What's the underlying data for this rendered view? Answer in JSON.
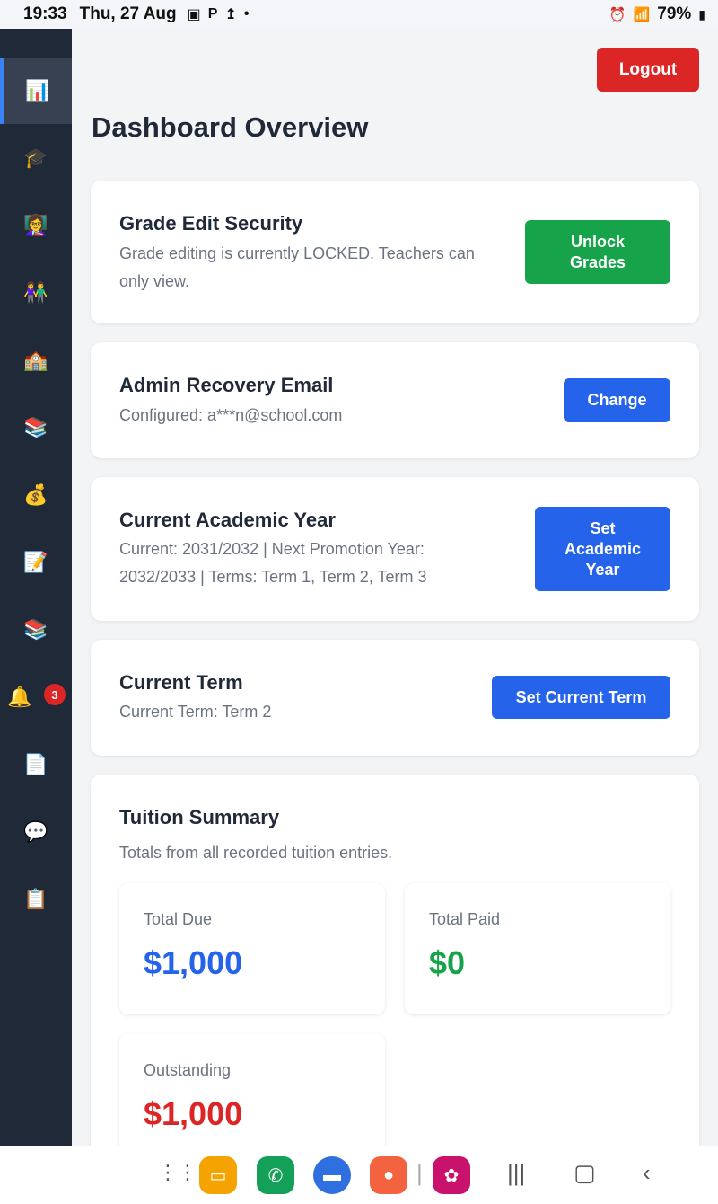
{
  "status_bar": {
    "time": "19:33",
    "date": "Thu, 27 Aug",
    "battery": "79%"
  },
  "sidebar": {
    "items": [
      {
        "icon": "📊",
        "name": "dashboard-icon"
      },
      {
        "icon": "🎓",
        "name": "graduation-cap-icon"
      },
      {
        "icon": "👩‍🏫",
        "name": "teacher-icon"
      },
      {
        "icon": "👫",
        "name": "students-icon"
      },
      {
        "icon": "🏫",
        "name": "school-icon"
      },
      {
        "icon": "📚",
        "name": "books-icon"
      },
      {
        "icon": "💰",
        "name": "money-bag-icon"
      },
      {
        "icon": "📝",
        "name": "memo-icon"
      },
      {
        "icon": "📚",
        "name": "library-icon"
      },
      {
        "icon": "🔔",
        "name": "bell-icon"
      },
      {
        "icon": "📄",
        "name": "document-icon"
      },
      {
        "icon": "💬",
        "name": "chat-icon"
      },
      {
        "icon": "📋",
        "name": "clipboard-icon"
      }
    ],
    "notification_count": "3"
  },
  "header": {
    "logout_label": "Logout",
    "page_title": "Dashboard Overview"
  },
  "cards": {
    "grade_security": {
      "title": "Grade Edit Security",
      "desc_line1": "Grade editing is currently LOCKED. Teachers can",
      "desc_line2": "only view.",
      "button_line1": "Unlock",
      "button_line2": "Grades"
    },
    "recovery_email": {
      "title": "Admin Recovery Email",
      "desc": "Configured: a***n@school.com",
      "button": "Change"
    },
    "academic_year": {
      "title": "Current Academic Year",
      "desc_line1": "Current: 2031/2032 | Next Promotion Year:",
      "desc_line2": "2032/2033 | Terms: Term 1, Term 2, Term 3",
      "button_line1": "Set",
      "button_line2": "Academic",
      "button_line3": "Year"
    },
    "current_term": {
      "title": "Current Term",
      "desc": "Current Term: Term 2",
      "button": "Set Current Term"
    },
    "tuition": {
      "title": "Tuition Summary",
      "desc": "Totals from all recorded tuition entries.",
      "total_due_label": "Total Due",
      "total_due_value": "$1,000",
      "total_paid_label": "Total Paid",
      "total_paid_value": "$0",
      "outstanding_label": "Outstanding",
      "outstanding_value": "$1,000"
    }
  },
  "colors": {
    "due": "#2563eb",
    "paid": "#16a34a",
    "outstanding": "#dc2626"
  }
}
